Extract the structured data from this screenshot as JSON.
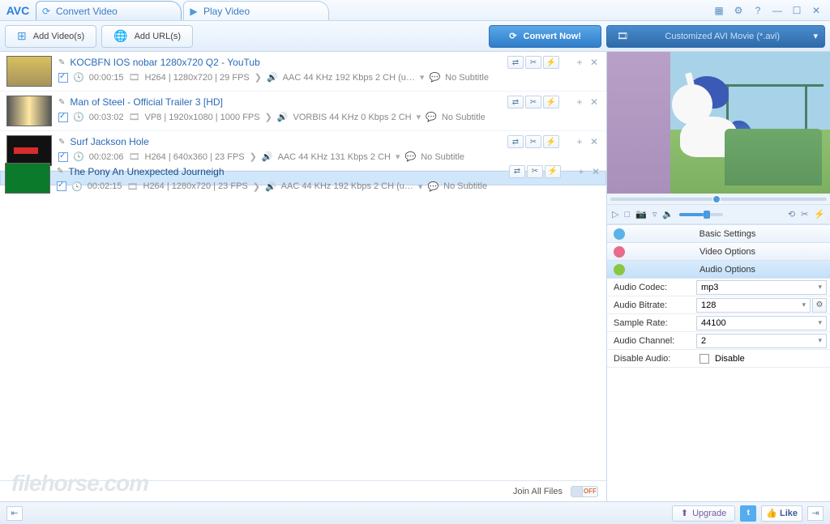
{
  "app": {
    "logo": "AVC"
  },
  "tabs": [
    {
      "icon": "⟳",
      "label": "Convert Video",
      "active": true
    },
    {
      "icon": "▶",
      "label": "Play Video",
      "active": false
    }
  ],
  "winbuttons": [
    "▦",
    "⚙",
    "?",
    "—",
    "☐",
    "✕"
  ],
  "toolbar": {
    "addvideo": {
      "icon": "⊞",
      "label": "Add Video(s)"
    },
    "addurl": {
      "icon": "🌐",
      "label": "Add URL(s)"
    },
    "convert": {
      "icon": "⟳",
      "label": "Convert Now!"
    },
    "profile": {
      "icon": "🎞",
      "label": "Customized AVI Movie (*.avi)",
      "arrow": "▾"
    }
  },
  "files": [
    {
      "title": "KOCBFN IOS nobar 1280x720 Q2 - YouTub",
      "duration": "00:00:15",
      "vinfo": "H264 | 1280x720 | 29 FPS",
      "ainfo": "AAC 44 KHz 192 Kbps 2 CH (u…",
      "subtitle": "No Subtitle",
      "selected": false
    },
    {
      "title": "Man of Steel - Official Trailer 3 [HD]",
      "duration": "00:03:02",
      "vinfo": "VP8 | 1920x1080 | 1000 FPS",
      "ainfo": "VORBIS 44 KHz 0 Kbps 2 CH",
      "subtitle": "No Subtitle",
      "selected": false
    },
    {
      "title": "Surf Jackson Hole",
      "duration": "00:02:06",
      "vinfo": "H264 | 640x360 | 23 FPS",
      "ainfo": "AAC 44 KHz 131 Kbps 2 CH",
      "subtitle": "No Subtitle",
      "selected": false
    },
    {
      "title": "The Pony An Unexpected Journeigh",
      "duration": "00:02:15",
      "vinfo": "H264 | 1280x720 | 23 FPS",
      "ainfo": "AAC 44 KHz 192 Kbps 2 CH (u…",
      "subtitle": "No Subtitle",
      "selected": true
    }
  ],
  "rowactions": {
    "repeat": "⇄",
    "cut": "✂",
    "fx": "⚡",
    "plus": "+",
    "close": "✕"
  },
  "rowmeta": {
    "pen": "✎",
    "clock": "🕓",
    "film": "🎞",
    "gear": "❯",
    "spk": "🔊",
    "sub": "💬",
    "dd": "▾"
  },
  "leftfoot": {
    "join": "Join All Files",
    "toggle": "OFF"
  },
  "watermark": "filehorse.com",
  "player": {
    "play": "▷",
    "stop": "□",
    "snap": "📷",
    "down": "▿",
    "vol": "🔈",
    "rot": "⟲",
    "cut": "✂",
    "fx": "⚡"
  },
  "sections": [
    {
      "label": "Basic Settings"
    },
    {
      "label": "Video Options"
    },
    {
      "label": "Audio Options"
    }
  ],
  "audio": {
    "codec": {
      "k": "Audio Codec:",
      "v": "mp3"
    },
    "bitrate": {
      "k": "Audio Bitrate:",
      "v": "128"
    },
    "sample": {
      "k": "Sample Rate:",
      "v": "44100"
    },
    "channel": {
      "k": "Audio Channel:",
      "v": "2"
    },
    "disable": {
      "k": "Disable Audio:",
      "v": "Disable"
    }
  },
  "bottom": {
    "upgrade": "Upgrade",
    "tw": "t",
    "like": "Like"
  }
}
